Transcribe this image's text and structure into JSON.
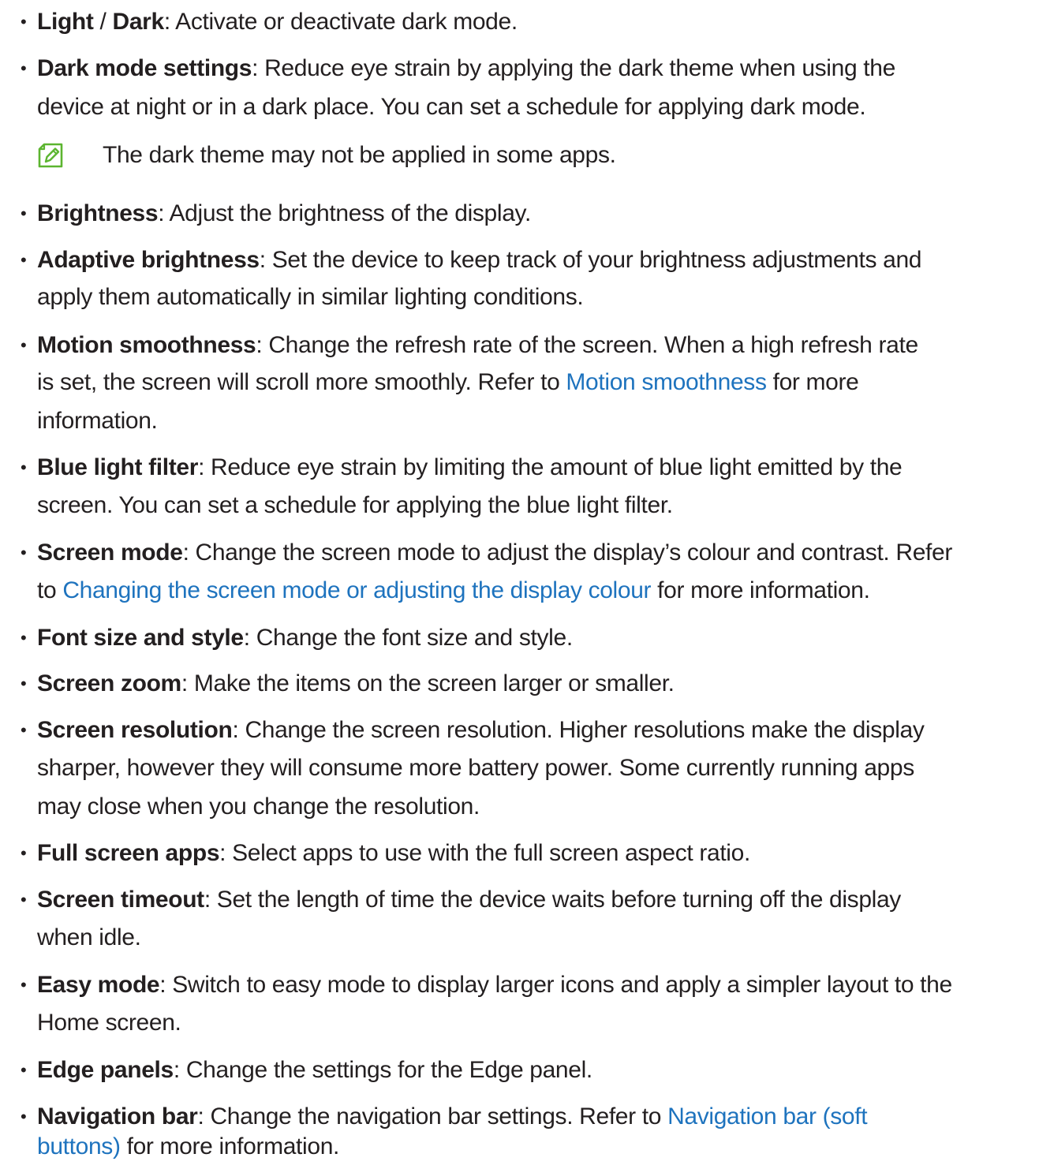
{
  "accent_color": "#1e73be",
  "note_icon_color": "#5cb530",
  "bullet_glyph": "•",
  "items": [
    {
      "term": "Light",
      "sep": " / ",
      "term2": "Dark",
      "text": ": Activate or deactivate dark mode."
    },
    {
      "term": "Dark mode settings",
      "text1": ": Reduce eye strain by applying the dark theme when using the",
      "text2": "device at night or in a dark place. You can set a schedule for applying dark mode."
    },
    {
      "note": "The dark theme may not be applied in some apps.",
      "icon": "note-pencil-icon"
    },
    {
      "term": "Brightness",
      "text": ": Adjust the brightness of the display."
    },
    {
      "term": "Adaptive brightness",
      "text1": ": Set the device to keep track of your brightness adjustments and",
      "text2": "apply them automatically in similar lighting conditions."
    },
    {
      "term": "Motion smoothness",
      "text1": ": Change the refresh rate of the screen. When a high refresh rate",
      "text2a": "is set, the screen will scroll more smoothly. Refer to ",
      "link": "Motion smoothness",
      "text2b": " for more",
      "text3": "information."
    },
    {
      "term": "Blue light filter",
      "text1": ": Reduce eye strain by limiting the amount of blue light emitted by the",
      "text2": "screen. You can set a schedule for applying the blue light filter."
    },
    {
      "term": "Screen mode",
      "text1": ": Change the screen mode to adjust the display’s colour and contrast. Refer",
      "text2a": "to ",
      "link": "Changing the screen mode or adjusting the display colour",
      "text2b": " for more information."
    },
    {
      "term": "Font size and style",
      "text": ": Change the font size and style."
    },
    {
      "term": "Screen zoom",
      "text": ": Make the items on the screen larger or smaller."
    },
    {
      "term": "Screen resolution",
      "text1": ": Change the screen resolution. Higher resolutions make the display",
      "text2": "sharper, however they will consume more battery power. Some currently running apps",
      "text3": "may close when you change the resolution."
    },
    {
      "term": "Full screen apps",
      "text": ": Select apps to use with the full screen aspect ratio."
    },
    {
      "term": "Screen timeout",
      "text1": ": Set the length of time the device waits before turning off the display",
      "text2": "when idle."
    },
    {
      "term": "Easy mode",
      "text1": ": Switch to easy mode to display larger icons and apply a simpler layout to the",
      "text2": "Home screen."
    },
    {
      "term": "Edge panels",
      "text": ": Change the settings for the Edge panel."
    },
    {
      "term": "Navigation bar",
      "text1a": ": Change the navigation bar settings. Refer to ",
      "link1": "Navigation bar (soft",
      "link2": "buttons)",
      "text2b": " for more information."
    }
  ]
}
